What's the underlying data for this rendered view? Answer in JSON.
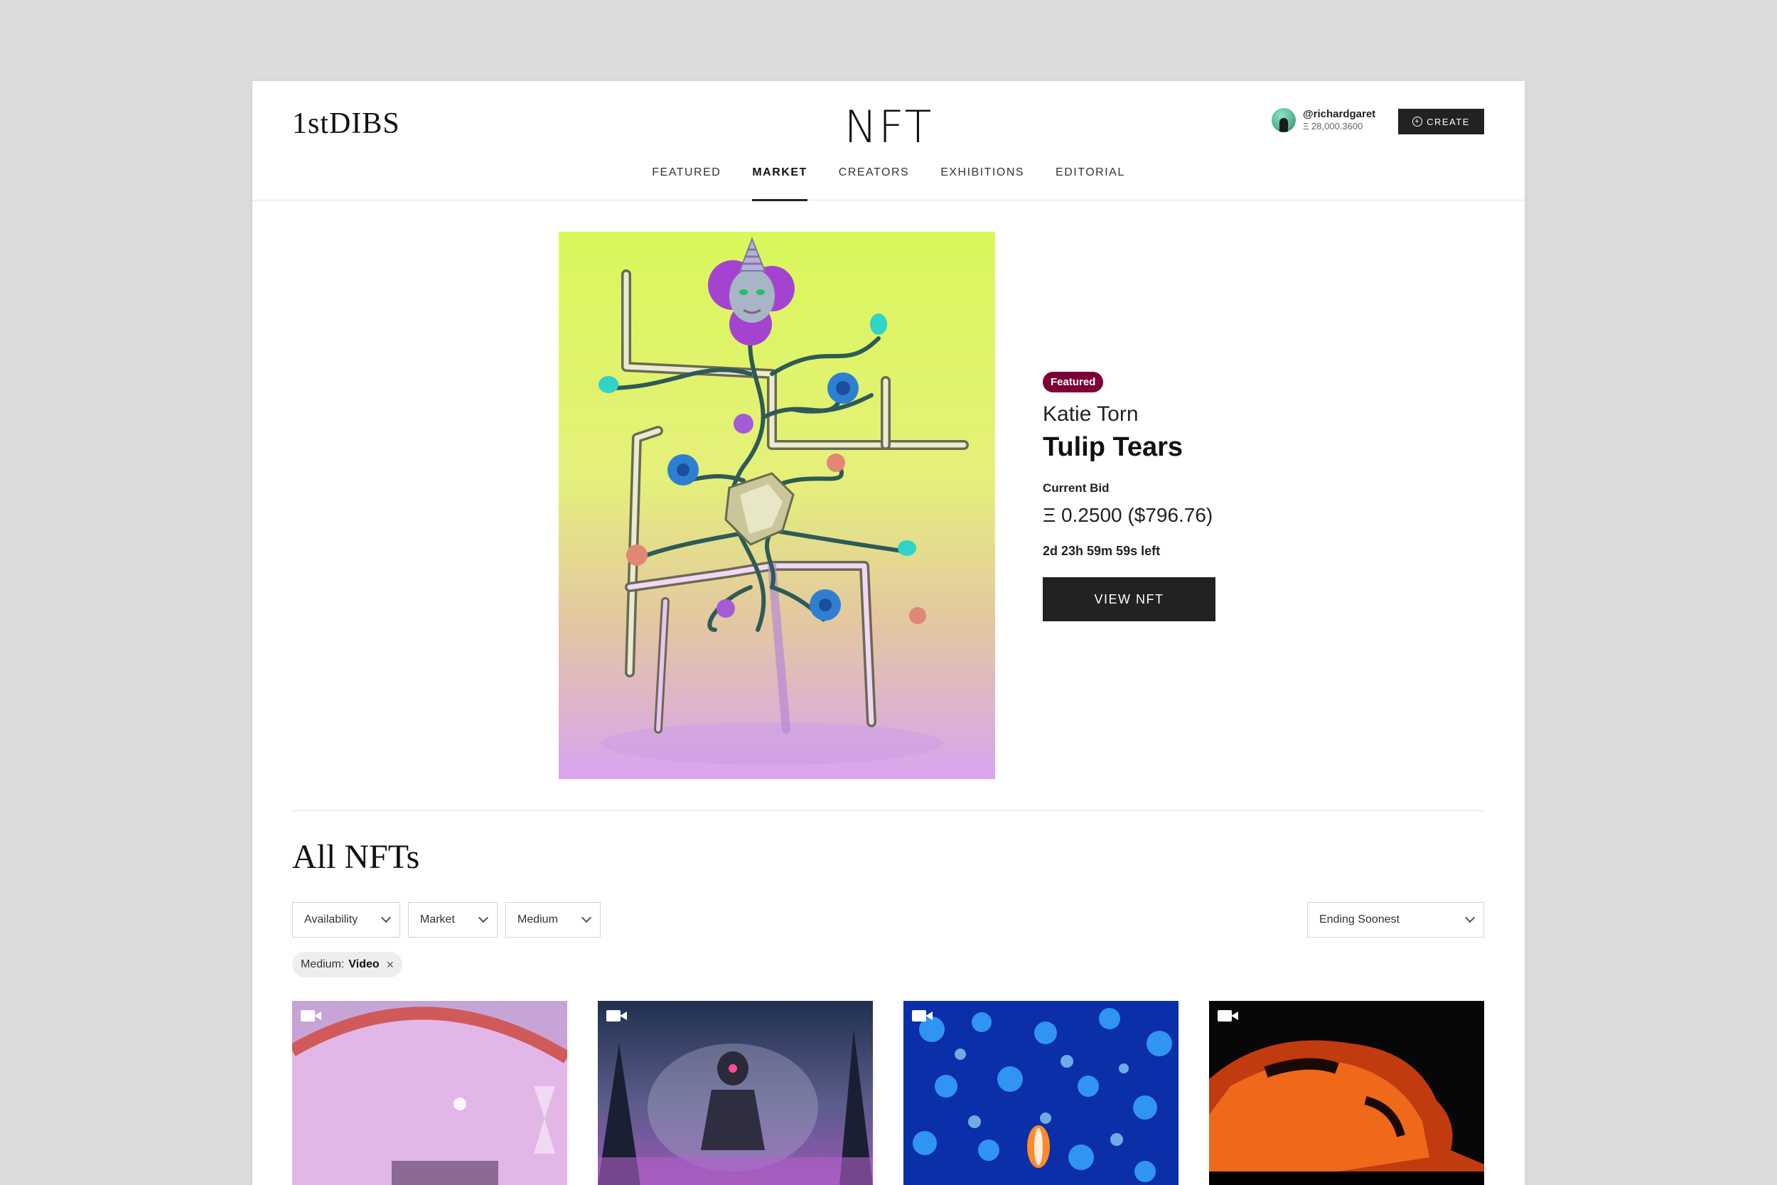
{
  "header": {
    "logo": "1stDIBS",
    "title": "NFT",
    "user": {
      "handle": "@richardgaret",
      "balance": "Ξ 28,000.3600"
    },
    "create_label": "CREATE"
  },
  "nav": {
    "items": [
      {
        "label": "FEATURED"
      },
      {
        "label": "MARKET"
      },
      {
        "label": "CREATORS"
      },
      {
        "label": "EXHIBITIONS"
      },
      {
        "label": "EDITORIAL"
      }
    ],
    "active": "MARKET"
  },
  "featured": {
    "badge": "Featured",
    "artist": "Katie Torn",
    "title": "Tulip Tears",
    "bid_label": "Current Bid",
    "bid_value": "Ξ 0.2500 ($796.76)",
    "time_left": "2d 23h 59m 59s left",
    "view_label": "VIEW NFT"
  },
  "all_nfts": {
    "title": "All NFTs",
    "filters": {
      "availability": "Availability",
      "market": "Market",
      "medium": "Medium",
      "sort": "Ending Soonest"
    },
    "active_filter": {
      "label": "Medium:",
      "value": "Video"
    }
  },
  "colors": {
    "accent": "#222222",
    "badge": "#7a0036"
  },
  "icons": [
    "plus-circle-icon",
    "chevron-down-icon",
    "close-icon",
    "video-camera-icon"
  ]
}
